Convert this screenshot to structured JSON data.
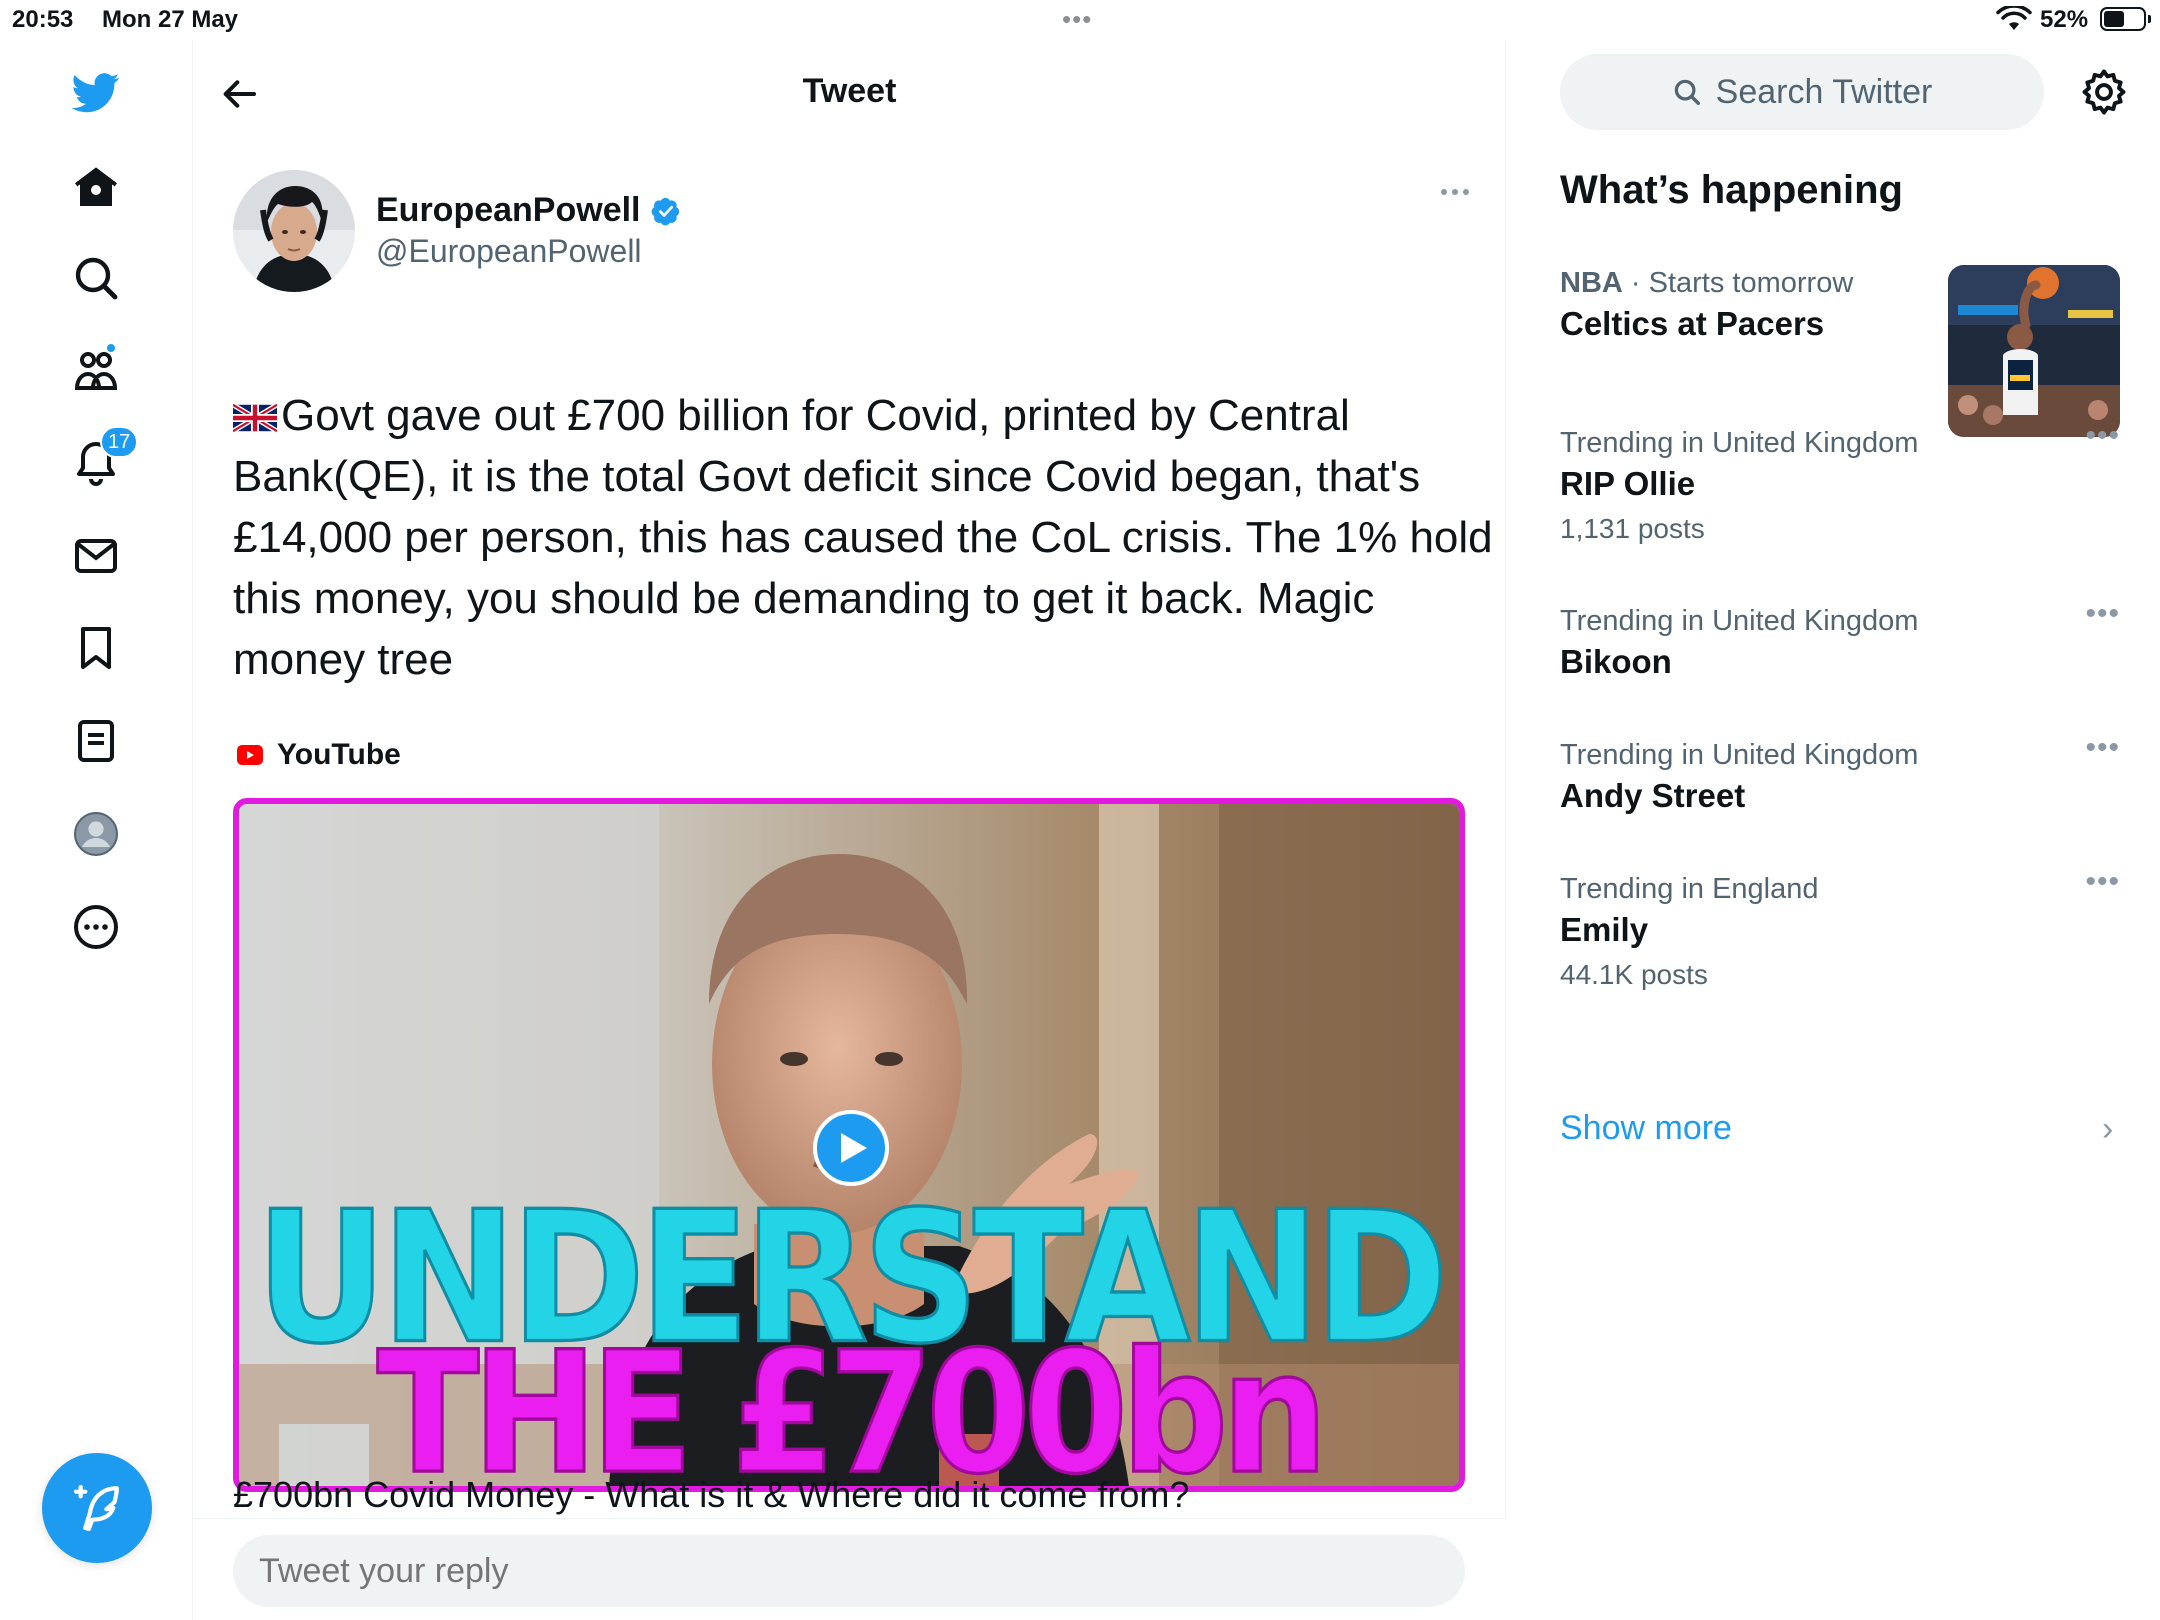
{
  "status_bar": {
    "time": "20:53",
    "date": "Mon 27 May",
    "battery": "52%",
    "battery_level": 0.52
  },
  "nav": {
    "notifications_badge": "17"
  },
  "header": {
    "title": "Tweet"
  },
  "tweet": {
    "author_name": "EuropeanPowell",
    "author_handle": "@EuropeanPowell",
    "text": "Govt gave out £700 billion for Covid, printed by Central Bank(QE), it is the total Govt deficit since Covid began, that's £14,000 per person, this has caused the CoL crisis. The 1% hold this money, you should be demanding to get it back. Magic money tree",
    "link_source": "YouTube",
    "media_caption_line1": "UNDERSTAND",
    "media_caption_line2": "THE £700bn",
    "video_title": "£700bn Covid Money - What is it & Where did it come from?"
  },
  "reply": {
    "placeholder": "Tweet your reply"
  },
  "sidebar": {
    "search_placeholder": "Search Twitter",
    "section_title": "What’s happening",
    "featured": {
      "category": "NBA",
      "meta": " · Starts tomorrow",
      "title": "Celtics at Pacers"
    },
    "trends": [
      {
        "context": "Trending in United Kingdom",
        "name": "RIP Ollie",
        "count": "1,131 posts"
      },
      {
        "context": "Trending in United Kingdom",
        "name": "Bikoon",
        "count": ""
      },
      {
        "context": "Trending in United Kingdom",
        "name": "Andy Street",
        "count": ""
      },
      {
        "context": "Trending in England",
        "name": "Emily",
        "count": "44.1K posts"
      }
    ],
    "show_more": "Show more"
  },
  "colors": {
    "accent": "#1d9bf0",
    "text": "#0f1419",
    "secondary": "#536471",
    "media_border": "#e21adf"
  }
}
